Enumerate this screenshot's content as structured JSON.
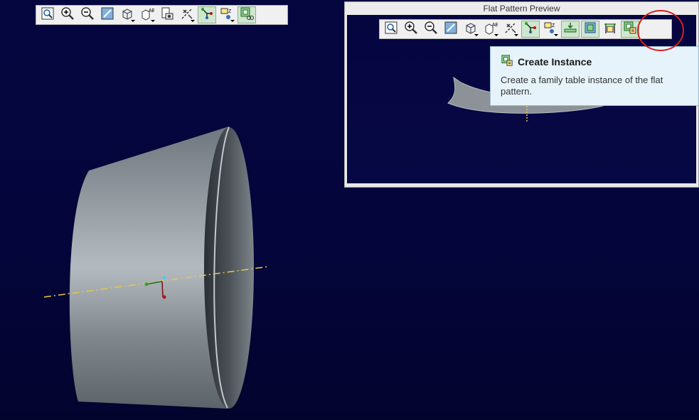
{
  "main_toolbar": {
    "items": [
      {
        "icon": "refit-icon"
      },
      {
        "icon": "zoom-in-icon"
      },
      {
        "icon": "zoom-out-icon"
      },
      {
        "icon": "repaint-icon"
      },
      {
        "icon": "display-style-icon"
      },
      {
        "icon": "named-views-icon"
      },
      {
        "icon": "saved-orientations-icon"
      },
      {
        "icon": "datum-display-icon"
      },
      {
        "icon": "sketch-point-icon"
      },
      {
        "icon": "spin-center-icon"
      },
      {
        "icon": "flat-pattern-preview-icon"
      }
    ]
  },
  "preview_window": {
    "title": "Flat Pattern Preview",
    "toolbar_items": [
      {
        "icon": "refit-icon"
      },
      {
        "icon": "zoom-in-icon"
      },
      {
        "icon": "zoom-out-icon"
      },
      {
        "icon": "repaint-icon"
      },
      {
        "icon": "display-style-icon"
      },
      {
        "icon": "named-views-icon"
      },
      {
        "icon": "datum-display-icon"
      },
      {
        "icon": "sketch-point-icon"
      },
      {
        "icon": "spin-center-icon"
      },
      {
        "icon": "flat-state-icon"
      },
      {
        "icon": "flat-pattern-icon"
      },
      {
        "icon": "measure-icon"
      },
      {
        "icon": "create-instance-icon"
      }
    ]
  },
  "tooltip": {
    "title": "Create Instance",
    "description": "Create a family table instance of the flat pattern."
  },
  "colors": {
    "viewport_bg": "#050640",
    "part_gray": "#9aa0a6",
    "axis_line": "#e8c64a",
    "highlight": "#d42020",
    "tooltip_bg": "#e6f3fb"
  }
}
